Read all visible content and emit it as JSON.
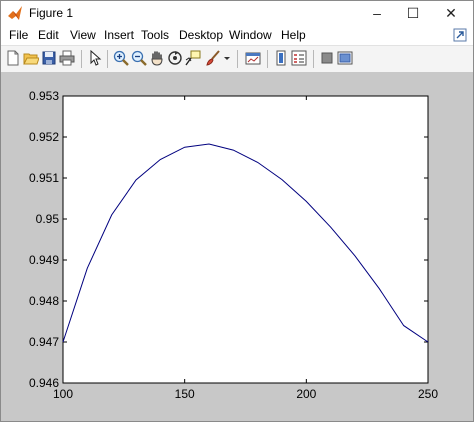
{
  "window": {
    "title": "Figure 1",
    "minimize_glyph": "–",
    "maximize_glyph": "☐",
    "close_glyph": "✕"
  },
  "menu": {
    "items": [
      "File",
      "Edit",
      "View",
      "Insert",
      "Tools",
      "Desktop",
      "Window",
      "Help"
    ]
  },
  "toolbar": {
    "icons": [
      "new-figure-icon",
      "open-file-icon",
      "save-icon",
      "print-icon",
      "edit-plot-arrow-icon",
      "zoom-in-icon",
      "zoom-out-icon",
      "pan-hand-icon",
      "rotate-3d-icon",
      "data-cursor-icon",
      "brush-icon",
      "brush-dropdown-icon",
      "link-plot-icon",
      "insert-colorbar-icon",
      "insert-legend-icon",
      "hide-plot-tools-icon",
      "show-plot-tools-icon"
    ]
  },
  "colors": {
    "figure_background": "#c8c8c8",
    "axes_background": "#ffffff",
    "line_color": "#00007f"
  },
  "chart_data": {
    "type": "line",
    "title": "",
    "xlabel": "",
    "ylabel": "",
    "xlim": [
      100,
      250
    ],
    "ylim": [
      0.946,
      0.953
    ],
    "x_ticks": [
      100,
      150,
      200,
      250
    ],
    "x_tick_labels": [
      "100",
      "150",
      "200",
      "250"
    ],
    "y_ticks": [
      0.946,
      0.947,
      0.948,
      0.949,
      0.95,
      0.951,
      0.952,
      0.953
    ],
    "y_tick_labels": [
      "0.946",
      "0.947",
      "0.948",
      "0.949",
      "0.95",
      "0.951",
      "0.952",
      "0.953"
    ],
    "grid": false,
    "series": [
      {
        "x": [
          100,
          110,
          120,
          130,
          140,
          150,
          160,
          170,
          180,
          190,
          200,
          210,
          220,
          230,
          240,
          250
        ],
        "y": [
          0.947,
          0.9488,
          0.9501,
          0.95095,
          0.95145,
          0.95175,
          0.95183,
          0.95168,
          0.95138,
          0.95096,
          0.95043,
          0.9498,
          0.9491,
          0.9483,
          0.9474,
          0.947
        ]
      }
    ]
  }
}
